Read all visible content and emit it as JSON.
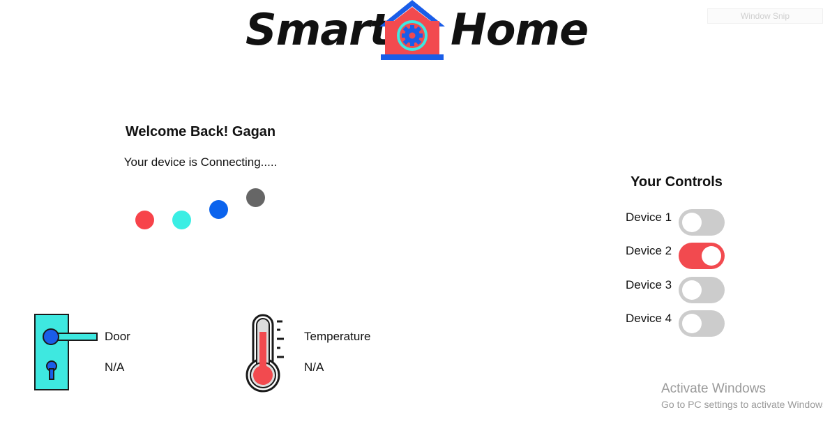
{
  "header": {
    "logo_left": "Smart",
    "logo_right": "Home",
    "logo_colors": {
      "roof": "#1a5de8",
      "house": "#f24a4f",
      "gear": "#3ee8e0"
    }
  },
  "snip": {
    "label": "Window Snip"
  },
  "welcome": {
    "title": "Welcome Back! Gagan",
    "status": "Your device is Connecting.....",
    "loading_dots": [
      {
        "color": "#f7434a"
      },
      {
        "color": "#3aeee4"
      },
      {
        "color": "#0b63ed"
      },
      {
        "color": "#666666"
      }
    ]
  },
  "controls": {
    "title": "Your Controls",
    "devices": [
      {
        "label": "Device 1",
        "on": false
      },
      {
        "label": "Device 2",
        "on": true
      },
      {
        "label": "Device 3",
        "on": false
      },
      {
        "label": "Device 4",
        "on": false
      }
    ],
    "on_color": "#f24a4f",
    "off_color": "#cccccc"
  },
  "sensors": {
    "door": {
      "label": "Door",
      "value": "N/A",
      "icon": "door-handle-icon"
    },
    "temperature": {
      "label": "Temperature",
      "value": "N/A",
      "icon": "thermometer-icon"
    }
  },
  "watermark": {
    "title": "Activate Windows",
    "subtitle": "Go to PC settings to activate Windows."
  }
}
